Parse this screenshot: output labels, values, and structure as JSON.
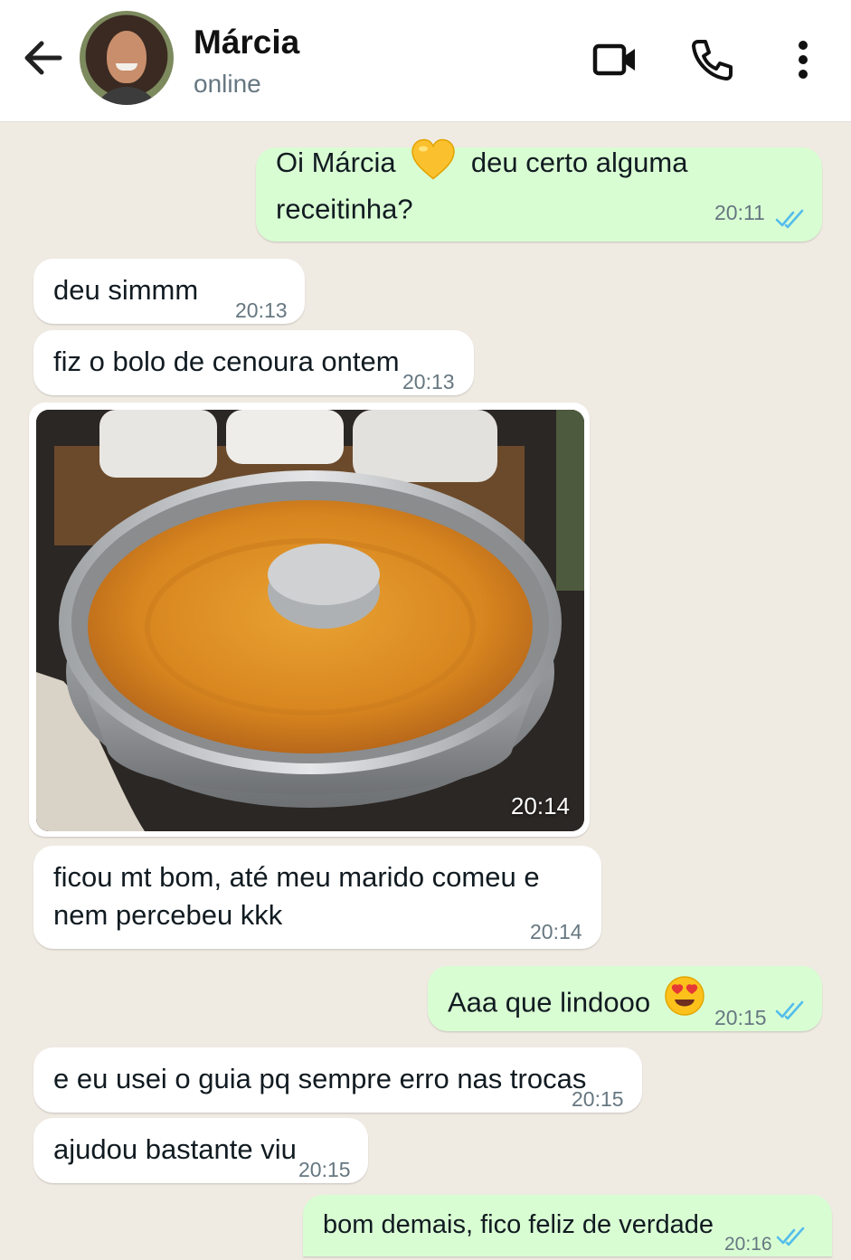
{
  "header": {
    "contact_name": "Márcia",
    "status": "online",
    "icons": [
      "back-arrow-icon",
      "avatar",
      "video-camera-icon",
      "phone-icon",
      "more-vertical-icon"
    ]
  },
  "colors": {
    "chat_background": "#efeae2",
    "incoming_bubble": "#ffffff",
    "outgoing_bubble": "#d9fdd3",
    "read_ticks": "#53bdeb",
    "timestamp": "#667781"
  },
  "messages": [
    {
      "direction": "out",
      "text_before": "Oi Márcia",
      "emoji": "yellow-heart",
      "text_after": "deu certo alguma receitinha?",
      "time": "20:11",
      "status": "read"
    },
    {
      "direction": "in",
      "text": "deu simmm",
      "time": "20:13"
    },
    {
      "direction": "in",
      "text": "fiz o bolo de cenoura ontem",
      "time": "20:13"
    },
    {
      "direction": "in",
      "type": "image",
      "image_description": "carrot-cake-in-bundt-pan",
      "time": "20:14"
    },
    {
      "direction": "in",
      "line1": "ficou mt bom, até meu marido comeu e",
      "line2": "nem percebeu kkk",
      "time": "20:14"
    },
    {
      "direction": "out",
      "text": "Aaa que lindooo",
      "emoji": "heart-eyes",
      "time": "20:15",
      "status": "read"
    },
    {
      "direction": "in",
      "text": "e eu usei o guia pq sempre erro nas trocas",
      "time": "20:15"
    },
    {
      "direction": "in",
      "text": "ajudou bastante viu",
      "time": "20:15"
    },
    {
      "direction": "out",
      "text": "bom demais, fico feliz de verdade",
      "time": "20:16",
      "status": "read"
    }
  ]
}
